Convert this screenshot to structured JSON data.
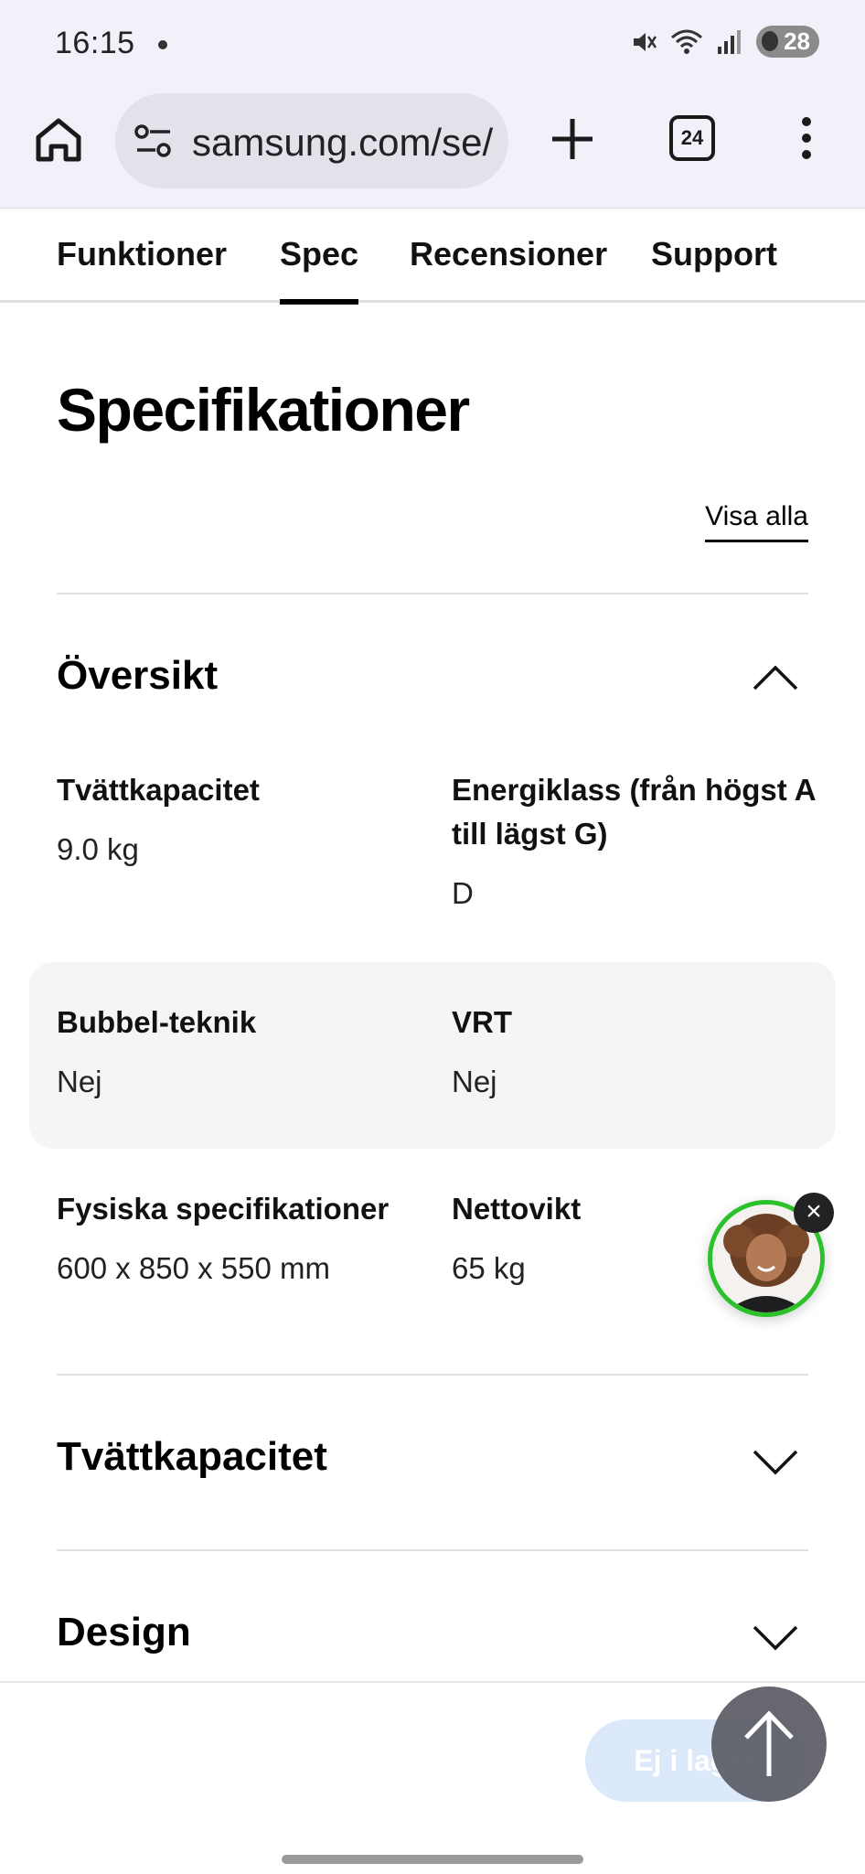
{
  "status_bar": {
    "time": "16:15",
    "battery": "28"
  },
  "browser": {
    "url": "samsung.com/se/",
    "tab_count": "24"
  },
  "nav_tabs": [
    {
      "label": "Funktioner",
      "active": false
    },
    {
      "label": "Spec",
      "active": true
    },
    {
      "label": "Recensioner",
      "active": false
    },
    {
      "label": "Support",
      "active": false
    }
  ],
  "page": {
    "title": "Specifikationer",
    "view_all": "Visa alla"
  },
  "overview": {
    "heading": "Översikt",
    "expanded": true,
    "rows": [
      {
        "shaded": false,
        "cells": [
          {
            "label": "Tvättkapacitet",
            "value": "9.0 kg"
          },
          {
            "label": "Energiklass (från högst A till lägst G)",
            "value": "D"
          }
        ]
      },
      {
        "shaded": true,
        "cells": [
          {
            "label": "Bubbel-teknik",
            "value": "Nej"
          },
          {
            "label": "VRT",
            "value": "Nej"
          }
        ]
      },
      {
        "shaded": false,
        "cells": [
          {
            "label": "Fysiska specifikationer",
            "value": "600 x 850 x 550 mm"
          },
          {
            "label": "Nettovikt",
            "value": "65 kg"
          }
        ]
      }
    ]
  },
  "sections": [
    {
      "heading": "Tvättkapacitet",
      "expanded": false
    },
    {
      "heading": "Design",
      "expanded": false
    }
  ],
  "bottom": {
    "buy_label": "Ej i lager"
  },
  "colors": {
    "chrome_bg": "#f3f0fa",
    "chat_ring": "#2bc12b",
    "buy_button": "#dbe9fb"
  }
}
